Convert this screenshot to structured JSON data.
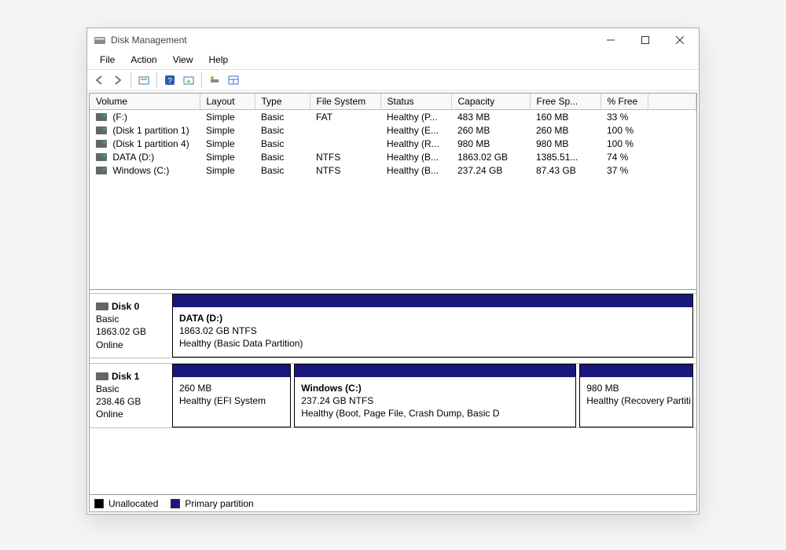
{
  "window": {
    "title": "Disk Management"
  },
  "menubar": [
    "File",
    "Action",
    "View",
    "Help"
  ],
  "vol_headers": [
    "Volume",
    "Layout",
    "Type",
    "File System",
    "Status",
    "Capacity",
    "Free Sp...",
    "% Free"
  ],
  "volumes": [
    {
      "name": "(F:)",
      "layout": "Simple",
      "type": "Basic",
      "fs": "FAT",
      "status": "Healthy (P...",
      "cap": "483 MB",
      "free": "160 MB",
      "pct": "33 %"
    },
    {
      "name": "(Disk 1 partition 1)",
      "layout": "Simple",
      "type": "Basic",
      "fs": "",
      "status": "Healthy (E...",
      "cap": "260 MB",
      "free": "260 MB",
      "pct": "100 %"
    },
    {
      "name": "(Disk 1 partition 4)",
      "layout": "Simple",
      "type": "Basic",
      "fs": "",
      "status": "Healthy (R...",
      "cap": "980 MB",
      "free": "980 MB",
      "pct": "100 %"
    },
    {
      "name": "DATA (D:)",
      "layout": "Simple",
      "type": "Basic",
      "fs": "NTFS",
      "status": "Healthy (B...",
      "cap": "1863.02 GB",
      "free": "1385.51...",
      "pct": "74 %"
    },
    {
      "name": "Windows (C:)",
      "layout": "Simple",
      "type": "Basic",
      "fs": "NTFS",
      "status": "Healthy (B...",
      "cap": "237.24 GB",
      "free": "87.43 GB",
      "pct": "37 %"
    }
  ],
  "disks": [
    {
      "name": "Disk 0",
      "type": "Basic",
      "size": "1863.02 GB",
      "status": "Online",
      "partitions": [
        {
          "title": "DATA  (D:)",
          "line2": "1863.02 GB NTFS",
          "line3": "Healthy (Basic Data Partition)",
          "flex": 1
        }
      ]
    },
    {
      "name": "Disk 1",
      "type": "Basic",
      "size": "238.46 GB",
      "status": "Online",
      "partitions": [
        {
          "title": "",
          "line2": "260 MB",
          "line3": "Healthy (EFI System",
          "flex": 0.23
        },
        {
          "title": "Windows  (C:)",
          "line2": "237.24 GB NTFS",
          "line3": "Healthy (Boot, Page File, Crash Dump, Basic D",
          "flex": 0.55
        },
        {
          "title": "",
          "line2": "980 MB",
          "line3": "Healthy (Recovery Partiti",
          "flex": 0.22
        }
      ]
    }
  ],
  "legend": [
    {
      "color": "#000000",
      "label": "Unallocated"
    },
    {
      "color": "#18187c",
      "label": "Primary partition"
    }
  ]
}
